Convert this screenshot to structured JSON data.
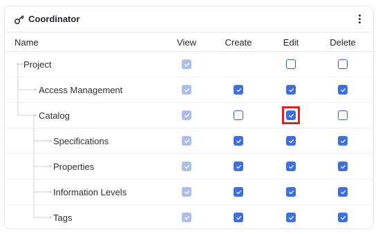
{
  "header": {
    "title": "Coordinator",
    "icon": "key-icon",
    "menu_icon": "more-vertical-icon"
  },
  "columns": {
    "name": "Name",
    "view": "View",
    "create": "Create",
    "edit": "Edit",
    "delete": "Delete"
  },
  "colors": {
    "checked": "#3f6fd8",
    "disabled_checked": "#aebfe6",
    "highlight": "#d8232a"
  },
  "rows": [
    {
      "label": "Project",
      "level": 0,
      "view": "checked-disabled",
      "create": "none",
      "edit": "unchecked",
      "delete": "unchecked"
    },
    {
      "label": "Access Management",
      "level": 1,
      "view": "checked-disabled",
      "create": "checked",
      "edit": "checked",
      "delete": "checked"
    },
    {
      "label": "Catalog",
      "level": 1,
      "view": "checked-disabled",
      "create": "unchecked",
      "edit": "checked",
      "delete": "unchecked",
      "highlighted": "edit"
    },
    {
      "label": "Specifications",
      "level": 2,
      "view": "checked-disabled",
      "create": "checked",
      "edit": "checked",
      "delete": "checked"
    },
    {
      "label": "Properties",
      "level": 2,
      "view": "checked-disabled",
      "create": "checked",
      "edit": "checked",
      "delete": "checked"
    },
    {
      "label": "Information Levels",
      "level": 2,
      "view": "checked-disabled",
      "create": "checked",
      "edit": "checked",
      "delete": "checked"
    },
    {
      "label": "Tags",
      "level": 2,
      "view": "checked-disabled",
      "create": "checked",
      "edit": "checked",
      "delete": "checked"
    }
  ]
}
